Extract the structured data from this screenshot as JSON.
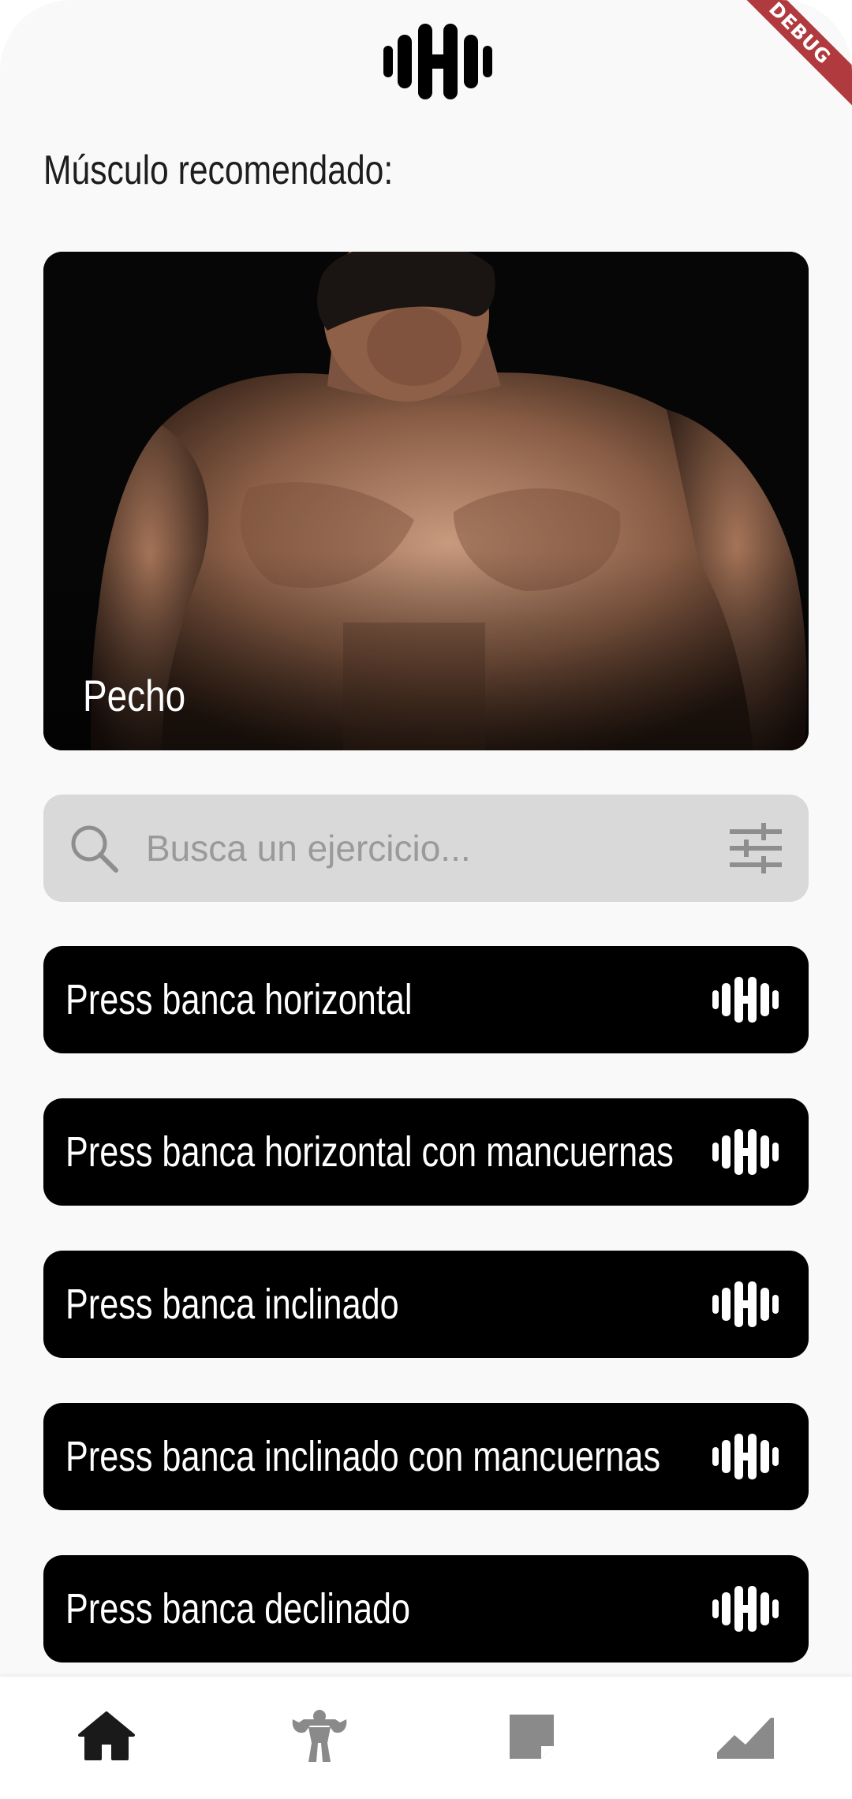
{
  "app": {
    "logo_icon": "dumbbell-icon",
    "debug_banner": "DEBUG"
  },
  "recommended": {
    "title": "Músculo recomendado:",
    "muscle_name": "Pecho",
    "image": "man-shirtless-chest-photo"
  },
  "search": {
    "placeholder": "Busca un ejercicio...",
    "value": "",
    "search_icon": "search-icon",
    "filter_icon": "filter-sliders-icon"
  },
  "exercises": [
    {
      "name": "Press banca horizontal",
      "icon": "dumbbell-icon"
    },
    {
      "name": "Press banca horizontal con mancuernas",
      "icon": "dumbbell-icon"
    },
    {
      "name": "Press banca inclinado",
      "icon": "dumbbell-icon"
    },
    {
      "name": "Press banca inclinado con mancuernas",
      "icon": "dumbbell-icon"
    },
    {
      "name": "Press banca declinado",
      "icon": "dumbbell-icon"
    }
  ],
  "bottom_nav": {
    "items": [
      {
        "icon": "home-icon",
        "active": true
      },
      {
        "icon": "muscle-body-icon",
        "active": false
      },
      {
        "icon": "note-icon",
        "active": false
      },
      {
        "icon": "progress-chart-icon",
        "active": false
      }
    ],
    "active_color": "#1a1a1a",
    "inactive_color": "#8a8a8a"
  },
  "colors": {
    "background": "#f9f9f9",
    "card": "#000000",
    "search_bg": "#d9d9d9",
    "debug_banner": "#b03a3e"
  }
}
